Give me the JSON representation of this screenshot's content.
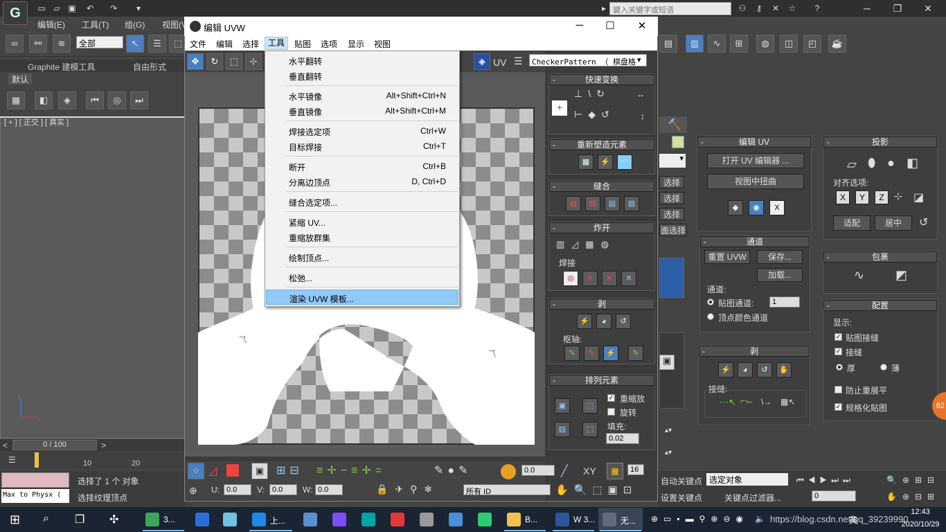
{
  "max": {
    "search_placeholder": "鍵入关键字或短语",
    "menubar": [
      "编辑(E)",
      "工具(T)",
      "组(G)",
      "视图(V"
    ],
    "select_filter": "全部",
    "ribbon_tabs": [
      "Graphite 建模工具",
      "自由形式"
    ],
    "ribbon_default": "默认",
    "viewport_label": "[ + ] [ 正交 ] [ 真实 ]",
    "time_slider": "0 / 100",
    "timeline_ticks": [
      "0",
      "10",
      "20"
    ],
    "status_selected": "选择了 1 个 对象",
    "status_prompt": "选择纹理顶点",
    "max_to_physx": "Max to Physx (",
    "auto_key": "自动关键点",
    "set_key": "设置关键点",
    "key_mode": "选定对象",
    "key_filters": "关键点过滤器...",
    "frame_value": "0",
    "frame_field": "0",
    "edge_badge": "82"
  },
  "cmd_panel": {
    "edit_uv": {
      "title": "编辑 UV",
      "open_editor": "打开 UV 编辑器 ...",
      "tweak_in_view": "视图中扭曲"
    },
    "channel": {
      "title": "通道",
      "reset_uvw": "重置 UVW",
      "save": "保存...",
      "load": "加载...",
      "channel_label": "通道:",
      "map_channel": "贴图通道:",
      "map_channel_value": "1",
      "vertex_color_channel": "顶点颜色通道"
    },
    "peel": {
      "title": "剥",
      "seams": "接缝:"
    },
    "projection": {
      "title": "投影",
      "align_options": "对齐选项:",
      "axes": [
        "X",
        "Y",
        "Z"
      ],
      "fit": "适配",
      "center": "居中"
    },
    "wrap": {
      "title": "包裹"
    },
    "config": {
      "title": "配置",
      "display": "显示:",
      "map_seams": "贴图接缝",
      "seams": "接缝",
      "thick": "厚",
      "thin": "薄",
      "prevent_reflatten": "防止重展平",
      "normalize_map": "规格化贴图"
    },
    "partial_labels": [
      "选择",
      "选择",
      "选择",
      "面选择"
    ]
  },
  "uvw": {
    "title": "编辑 UVW",
    "menu": [
      "文件",
      "编辑",
      "选择",
      "工具",
      "贴图",
      "选项",
      "显示",
      "视图"
    ],
    "active_menu_index": 3,
    "uv_label": "UV",
    "checker": "CheckerPattern （ 棋盘格",
    "rollouts": {
      "quick_transform": "快速变换",
      "reshape_elements": "重新塑造元素",
      "stitch": "缝合",
      "explode": "炸开",
      "weld": "焊接",
      "peel": "剥",
      "pivot": "枢轴:",
      "arrange_elements": "排列元素",
      "rescale": "重缩放",
      "rotate": "旋转",
      "padding": "填充:",
      "padding_value": "0.02"
    },
    "bottom": {
      "value_0": "0.0",
      "xy": "XY",
      "num_16": "16",
      "u_label": "U:",
      "u_value": "0.0",
      "v_label": "V:",
      "v_value": "0.0",
      "w_label": "W:",
      "w_value": "0.0",
      "id_select": "所有 ID"
    }
  },
  "tools_menu": [
    {
      "label": "水平翻转",
      "shortcut": ""
    },
    {
      "label": "垂直翻转",
      "shortcut": ""
    },
    {
      "sep": true
    },
    {
      "label": "水平镜像",
      "shortcut": "Alt+Shift+Ctrl+N"
    },
    {
      "label": "垂直镜像",
      "shortcut": "Alt+Shift+Ctrl+M"
    },
    {
      "sep": true
    },
    {
      "label": "焊接选定项",
      "shortcut": "Ctrl+W"
    },
    {
      "label": "目标焊接",
      "shortcut": "Ctrl+T"
    },
    {
      "sep": true
    },
    {
      "label": "断开",
      "shortcut": "Ctrl+B"
    },
    {
      "label": "分离边顶点",
      "shortcut": "D, Ctrl+D"
    },
    {
      "sep": true
    },
    {
      "label": "缝合选定项...",
      "shortcut": ""
    },
    {
      "sep": true
    },
    {
      "label": "紧缩 UV...",
      "shortcut": ""
    },
    {
      "label": "重缩放群集",
      "shortcut": ""
    },
    {
      "sep": true
    },
    {
      "label": "绘制顶点...",
      "shortcut": ""
    },
    {
      "sep": true
    },
    {
      "label": "松弛...",
      "shortcut": ""
    },
    {
      "sep": true
    },
    {
      "label": "渲染 UVW 模板...",
      "shortcut": "",
      "highlighted": true
    }
  ],
  "taskbar": {
    "apps": [
      {
        "name": "max-app",
        "label": "3...",
        "color": "#3ba55c"
      },
      {
        "name": "k-app",
        "label": "",
        "color": "#2a6fd6"
      },
      {
        "name": "notes-app",
        "label": "",
        "color": "#6fc3e0"
      },
      {
        "name": "browser-app",
        "label": "上...",
        "color": "#1e88e5"
      },
      {
        "name": "calculator-app",
        "label": "",
        "color": "#5a8fd0"
      },
      {
        "name": "vs-app",
        "label": "",
        "color": "#7c4dff"
      },
      {
        "name": "p-app",
        "label": "",
        "color": "#00a4a6"
      },
      {
        "name": "chrome-app",
        "label": "",
        "color": "#e53935"
      },
      {
        "name": "z-app",
        "label": "",
        "color": "#999999"
      },
      {
        "name": "bird-app",
        "label": "",
        "color": "#4a90d9"
      },
      {
        "name": "player-app",
        "label": "",
        "color": "#2ecc71"
      },
      {
        "name": "explorer-app",
        "label": "B...",
        "color": "#f2c14e"
      },
      {
        "name": "word-app",
        "label": "W 3...",
        "color": "#2b579a"
      },
      {
        "name": "max2-app",
        "label": "无...",
        "color": "#5f6b7a"
      }
    ],
    "tray_text": "https://blog.csdn.net/qq_39239990",
    "lang": "英",
    "time": "12:43",
    "date": "2020/10/29"
  }
}
